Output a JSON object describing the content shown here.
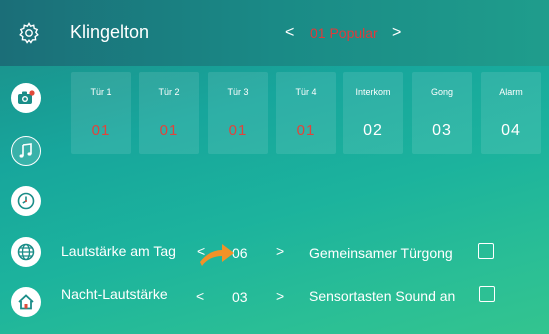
{
  "header": {
    "title": "Klingelton",
    "preset": "01 Popular",
    "prev_label": "<",
    "next_label": ">"
  },
  "sidebar": {
    "items": [
      {
        "icon": "camera-settings-icon"
      },
      {
        "icon": "music-note-icon"
      },
      {
        "icon": "clock-icon"
      },
      {
        "icon": "globe-icon"
      },
      {
        "icon": "home-icon"
      }
    ]
  },
  "ringtones": [
    {
      "label": "Tür 1",
      "value": "01"
    },
    {
      "label": "Tür 2",
      "value": "01"
    },
    {
      "label": "Tür 3",
      "value": "01"
    },
    {
      "label": "Tür 4",
      "value": "01"
    },
    {
      "label": "Interkom",
      "value": "02"
    },
    {
      "label": "Gong",
      "value": "03"
    },
    {
      "label": "Alarm",
      "value": "04"
    }
  ],
  "volume": {
    "day_label": "Lautstärke am Tag",
    "day_value": "06",
    "night_label": "Nacht-Lautstärke",
    "night_value": "03",
    "left": "<",
    "right": ">"
  },
  "options": {
    "shared_gong_label": "Gemeinsamer Türgong",
    "touch_sound_label": "Sensortasten Sound an"
  },
  "colors": {
    "accent_red": "#e0443c",
    "bg_teal": "#17a69c"
  }
}
